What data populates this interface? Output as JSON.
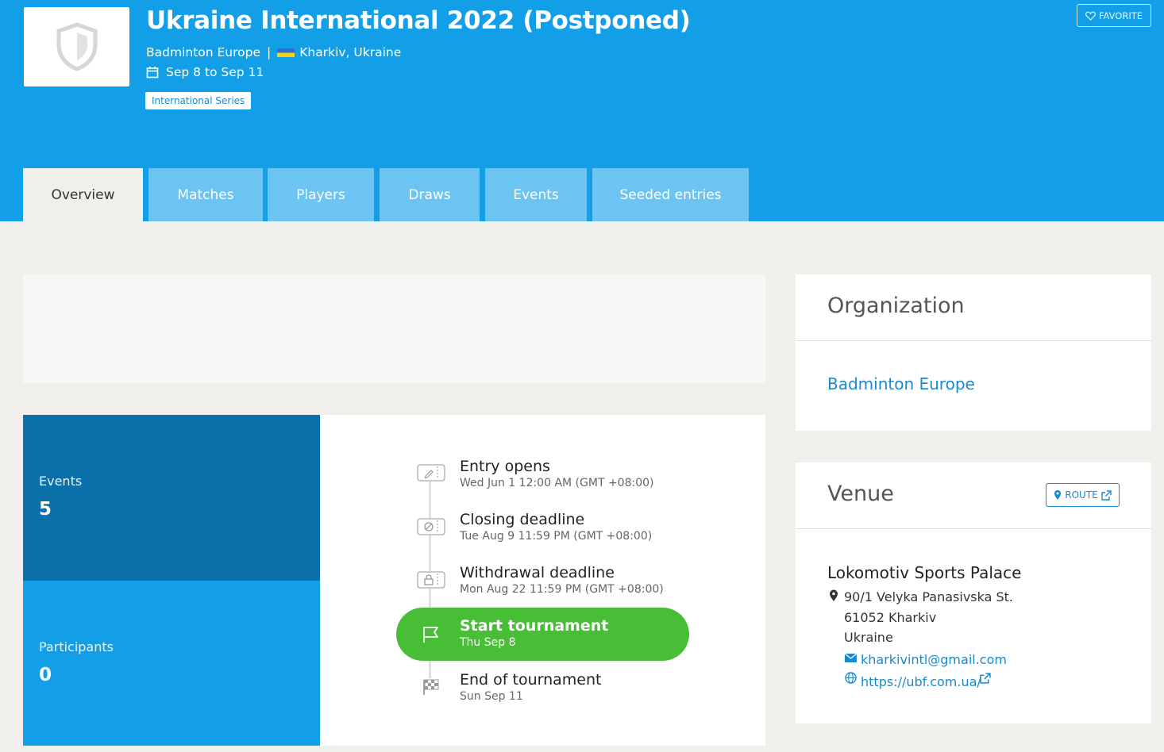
{
  "header": {
    "title": "Ukraine International 2022 (Postponed)",
    "organizer": "Badminton Europe",
    "separator": "|",
    "location": "Kharkiv, Ukraine",
    "dates": "Sep 8 to Sep 11",
    "category_badge": "International Series",
    "favorite_label": "FAVORITE",
    "brand_color": "#139fe8"
  },
  "tabs": [
    {
      "label": "Overview",
      "active": true
    },
    {
      "label": "Matches",
      "active": false
    },
    {
      "label": "Players",
      "active": false
    },
    {
      "label": "Draws",
      "active": false
    },
    {
      "label": "Events",
      "active": false
    },
    {
      "label": "Seeded entries",
      "active": false
    }
  ],
  "stats": {
    "events_label": "Events",
    "events_value": "5",
    "participants_label": "Participants",
    "participants_value": "0"
  },
  "timeline": [
    {
      "title": "Entry opens",
      "date": "Wed Jun 1 12:00 AM (GMT +08:00)",
      "icon": "ticket-edit-icon"
    },
    {
      "title": "Closing deadline",
      "date": "Tue Aug 9 11:59 PM (GMT +08:00)",
      "icon": "ticket-blocked-icon"
    },
    {
      "title": "Withdrawal deadline",
      "date": "Mon Aug 22 11:59 PM (GMT +08:00)",
      "icon": "ticket-lock-icon"
    },
    {
      "title": "Start tournament",
      "date": "Thu Sep 8",
      "icon": "flag-icon",
      "active": true,
      "color": "#47be35"
    },
    {
      "title": "End of tournament",
      "date": "Sun Sep 11",
      "icon": "checkered-flag-icon"
    }
  ],
  "organization": {
    "heading": "Organization",
    "name": "Badminton Europe"
  },
  "venue": {
    "heading": "Venue",
    "route_label": "ROUTE",
    "name": "Lokomotiv Sports Palace",
    "address_line1": "90/1 Velyka Panasivska St.",
    "address_line2": "61052 Kharkiv",
    "address_line3": "Ukraine",
    "email": "kharkivintl@gmail.com",
    "website": "https://ubf.com.ua/"
  }
}
